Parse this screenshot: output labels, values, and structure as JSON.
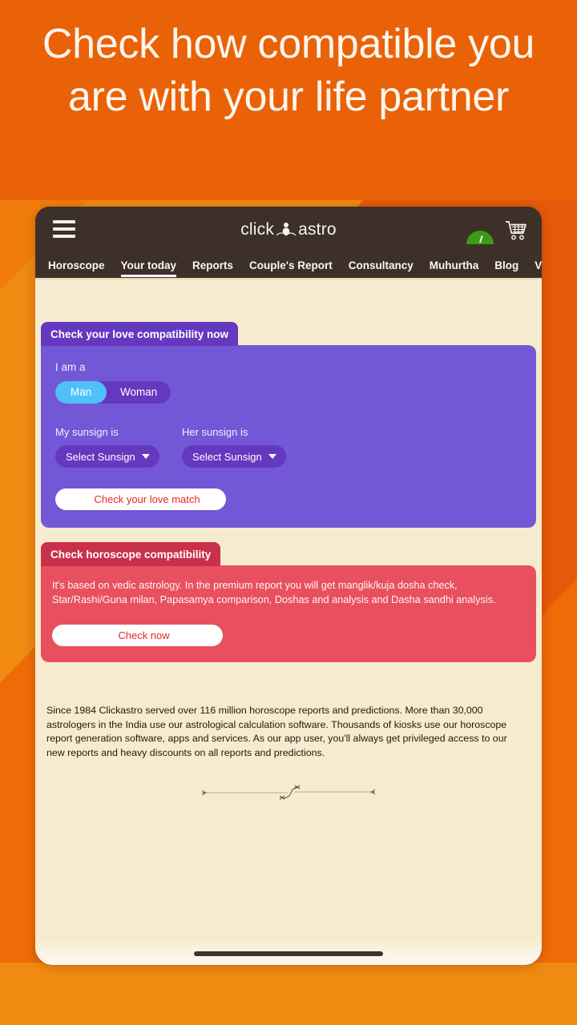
{
  "headline": "Check how compatible you are with your life partner",
  "colors": {
    "page_background": "#EE6B08",
    "screen_background": "#F7EBCF",
    "app_bar": "#3D3029",
    "purple_card": "#7258D6",
    "purple_card_tab": "#6438BF",
    "red_card": "#E8505F",
    "red_card_tab": "#C9304A",
    "accent_selected": "#4FC1F7",
    "button_text": "#E8232A",
    "gauge_green": "#3A9B16"
  },
  "app_bar": {
    "menu_icon": "hamburger-menu-icon",
    "logo_text_left": "click",
    "logo_text_right": "astro",
    "logo_mark": "meditating-figure-icon",
    "gauge_icon": "green-gauge-icon",
    "cart_icon": "shopping-cart-icon"
  },
  "nav": {
    "tabs": [
      {
        "label": "Horoscope",
        "active": false
      },
      {
        "label": "Your today",
        "active": true
      },
      {
        "label": "Reports",
        "active": false
      },
      {
        "label": "Couple's Report",
        "active": false
      },
      {
        "label": "Consultancy",
        "active": false
      },
      {
        "label": "Muhurtha",
        "active": false
      },
      {
        "label": "Blog",
        "active": false
      },
      {
        "label": "Videos",
        "active": false
      }
    ]
  },
  "love_card": {
    "tab_title": "Check your love compatibility now",
    "gender_label": "I am a",
    "gender_options": [
      {
        "label": "Man",
        "selected": true
      },
      {
        "label": "Woman",
        "selected": false
      }
    ],
    "my_sunsign_label": "My sunsign is",
    "her_sunsign_label": "Her sunsign is",
    "my_sunsign_value": "Select Sunsign",
    "her_sunsign_value": "Select Sunsign",
    "button_label": "Check your love match"
  },
  "horoscope_card": {
    "tab_title": "Check horoscope compatibility",
    "description": "It's based on vedic astrology. In the premium report you will get manglik/kuja dosha check, Star/Rashi/Guna milan, Papasamya comparison, Doshas and analysis and Dasha sandhi analysis.",
    "button_label": "Check now"
  },
  "footer": {
    "blurb": "Since 1984 Clickastro served over 116 million horoscope reports and predictions. More than 30,000 astrologers in the India use our astrological calculation software. Thousands of kiosks use our horoscope report generation software, apps and services. As our app user, you'll always get privileged access to our new reports and heavy discounts on all reports and predictions.",
    "divider_icon": "ornamental-divider-icon"
  }
}
